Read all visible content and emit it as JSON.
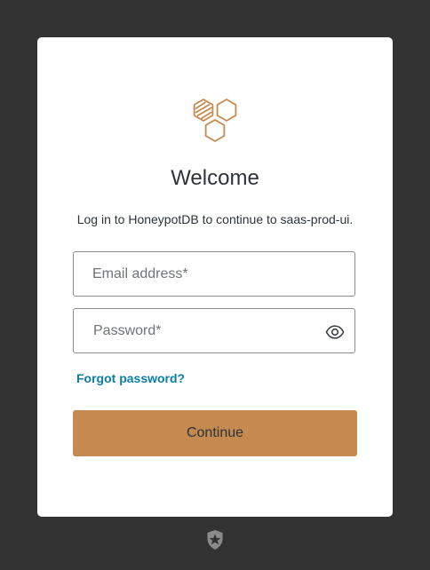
{
  "login": {
    "title": "Welcome",
    "subtitle": "Log in to HoneypotDB to continue to saas-prod-ui.",
    "email": {
      "value": "",
      "placeholder": "Email address*"
    },
    "password": {
      "value": "",
      "placeholder": "Password*"
    },
    "forgot_password": "Forgot password?",
    "continue_label": "Continue"
  },
  "icons": {
    "brand_logo": "honeycomb-logo-icon",
    "show_password": "eye-icon",
    "footer": "auth0-shield-icon"
  },
  "colors": {
    "background": "#333333",
    "card": "#ffffff",
    "logo": "#c48a50",
    "accent_button": "#c48a50",
    "link": "#0a7ea8",
    "text": "#2d333a"
  }
}
